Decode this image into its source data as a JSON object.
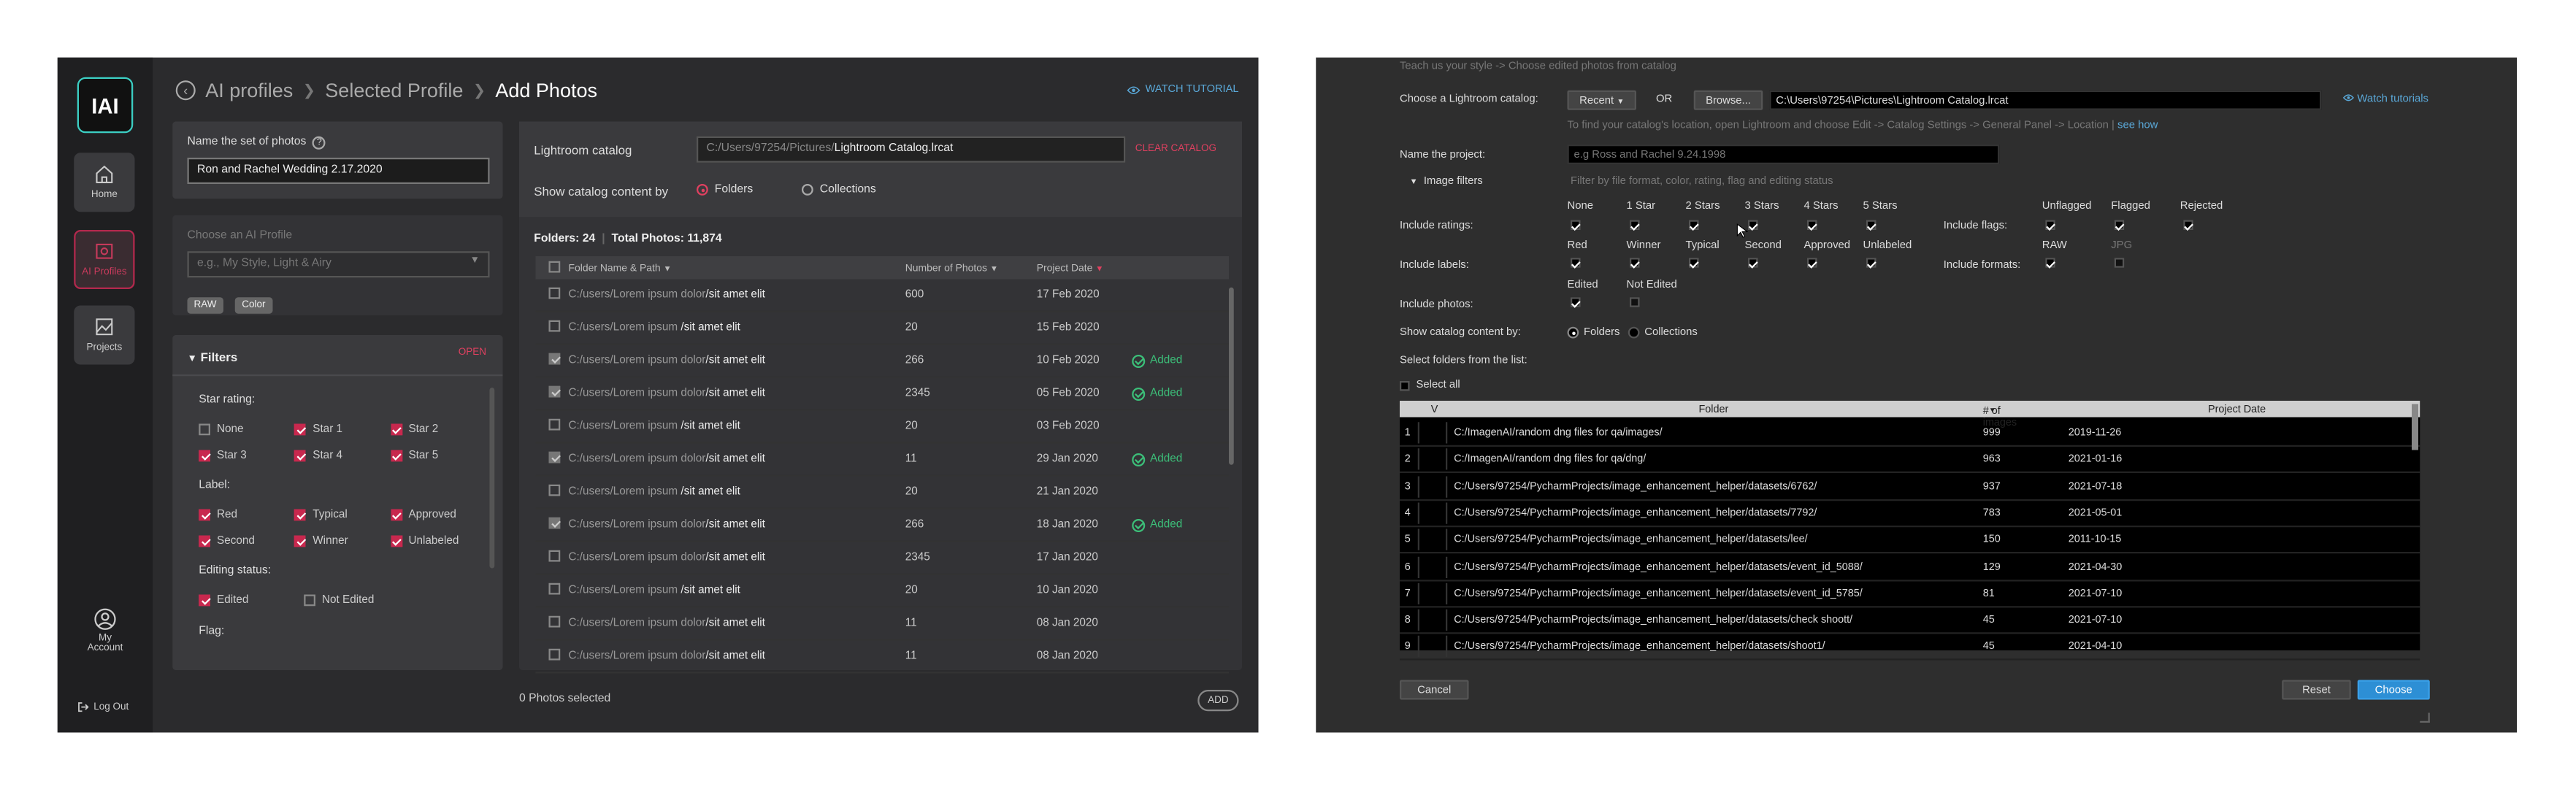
{
  "left": {
    "logo": "IAI",
    "nav": [
      {
        "label": "Home",
        "icon": "home-icon"
      },
      {
        "label": "AI Profiles",
        "icon": "ai-profiles-icon",
        "active": true
      },
      {
        "label": "Projects",
        "icon": "projects-icon"
      }
    ],
    "account_label_1": "My",
    "account_label_2": "Account",
    "logout_label": "Log Out",
    "breadcrumb": {
      "items": [
        "AI profiles",
        "Selected Profile"
      ],
      "current": "Add Photos"
    },
    "watch_tutorial": "WATCH TUTORIAL",
    "name_set": {
      "label": "Name the set of photos",
      "value": "Ron and Rachel Wedding 2.17.2020"
    },
    "ai_profile": {
      "label": "Choose an AI Profile",
      "placeholder": "e.g., My Style, Light & Airy",
      "tags": [
        "RAW",
        "Color"
      ]
    },
    "filters": {
      "title": "Filters",
      "open_label": "OPEN",
      "star_rating_label": "Star rating:",
      "stars": [
        {
          "label": "None",
          "checked": false
        },
        {
          "label": "Star 1",
          "checked": true
        },
        {
          "label": "Star 2",
          "checked": true
        },
        {
          "label": "Star 3",
          "checked": true
        },
        {
          "label": "Star 4",
          "checked": true
        },
        {
          "label": "Star 5",
          "checked": true
        }
      ],
      "label_label": "Label:",
      "labels": [
        {
          "label": "Red",
          "checked": true
        },
        {
          "label": "Typical",
          "checked": true
        },
        {
          "label": "Approved",
          "checked": true
        },
        {
          "label": "Second",
          "checked": true
        },
        {
          "label": "Winner",
          "checked": true
        },
        {
          "label": "Unlabeled",
          "checked": true
        }
      ],
      "editing_label": "Editing status:",
      "editing": [
        {
          "label": "Edited",
          "checked": true
        },
        {
          "label": "Not Edited",
          "checked": false
        }
      ],
      "flag_label": "Flag:"
    },
    "catalog": {
      "label": "Lightroom catalog",
      "path_prefix": "C:/Users/97254/Pictures/",
      "path_file": "Lightroom Catalog.lrcat",
      "clear": "CLEAR CATALOG",
      "show_by_label": "Show catalog content by",
      "options": [
        "Folders",
        "Collections"
      ],
      "folders_count": "Folders: 24",
      "total_photos": "Total Photos: 11,874"
    },
    "table": {
      "headers": [
        "Folder Name & Path",
        "Number of Photos",
        "Project Date"
      ],
      "rows": [
        {
          "prefix": "C:/users/Lorem ipsum dolor",
          "suffix": "/sit amet elit",
          "count": "600",
          "date": "17 Feb 2020",
          "status": "",
          "checked": false
        },
        {
          "prefix": "C:/users/Lorem ipsum",
          "suffix": " /sit amet elit",
          "count": "20",
          "date": "15 Feb 2020",
          "status": "",
          "checked": false
        },
        {
          "prefix": "C:/users/Lorem ipsum dolor",
          "suffix": "/sit amet elit",
          "count": "266",
          "date": "10 Feb 2020",
          "status": "Added",
          "checked": true
        },
        {
          "prefix": "C:/users/Lorem ipsum dolor",
          "suffix": "/sit amet elit",
          "count": "2345",
          "date": "05 Feb 2020",
          "status": "Added",
          "checked": true
        },
        {
          "prefix": "C:/users/Lorem ipsum",
          "suffix": " /sit amet elit",
          "count": "20",
          "date": "03 Feb 2020",
          "status": "",
          "checked": false
        },
        {
          "prefix": "C:/users/Lorem ipsum dolor",
          "suffix": "/sit amet elit",
          "count": "11",
          "date": "29 Jan 2020",
          "status": "Added",
          "checked": true
        },
        {
          "prefix": "C:/users/Lorem ipsum",
          "suffix": " /sit amet elit",
          "count": "20",
          "date": "21 Jan 2020",
          "status": "",
          "checked": false
        },
        {
          "prefix": "C:/users/Lorem ipsum dolor",
          "suffix": "/sit amet elit",
          "count": "266",
          "date": "18 Jan 2020",
          "status": "Added",
          "checked": true
        },
        {
          "prefix": "C:/users/Lorem ipsum dolor",
          "suffix": "/sit amet elit",
          "count": "2345",
          "date": "17 Jan 2020",
          "status": "",
          "checked": false
        },
        {
          "prefix": "C:/users/Lorem ipsum",
          "suffix": " /sit amet elit",
          "count": "20",
          "date": "10 Jan 2020",
          "status": "",
          "checked": false
        },
        {
          "prefix": "C:/users/Lorem ipsum dolor",
          "suffix": "/sit amet elit",
          "count": "11",
          "date": "08 Jan 2020",
          "status": "",
          "checked": false
        },
        {
          "prefix": "C:/users/Lorem ipsum dolor",
          "suffix": "/sit amet elit",
          "count": "11",
          "date": "08 Jan 2020",
          "status": "",
          "checked": false
        }
      ]
    },
    "selected_count": "0 Photos selected",
    "add_label": "ADD",
    "colors": {
      "accent": "#c8284e",
      "added": "#3cbf79",
      "link": "#5aa8d8",
      "logo_border": "#3ccfc4"
    }
  },
  "right": {
    "top_hint": "Teach us your style -> Choose edited photos from catalog",
    "catalog_label": "Choose a Lightroom catalog:",
    "recent_label": "Recent",
    "or_label": "OR",
    "browse_label": "Browse...",
    "catalog_path": "C:\\Users\\97254\\Pictures\\Lightroom Catalog.lrcat",
    "watch_label": "Watch tutorials",
    "catalog_hint": "To find your catalog's location, open Lightroom and choose  Edit -> Catalog Settings -> General Panel -> Location",
    "see_how": "see how",
    "project_label": "Name the project:",
    "project_placeholder": "e.g Ross and Rachel 9.24.1998",
    "filters_label": "Image filters",
    "filters_hint": "Filter by file format, color, rating, flag and editing status",
    "ratings_label": "Include ratings:",
    "ratings": [
      {
        "label": "None",
        "checked": true
      },
      {
        "label": "1 Star",
        "checked": true
      },
      {
        "label": "2 Stars",
        "checked": true
      },
      {
        "label": "3 Stars",
        "checked": true
      },
      {
        "label": "4 Stars",
        "checked": true
      },
      {
        "label": "5 Stars",
        "checked": true
      }
    ],
    "flags_label": "Include flags:",
    "flags": [
      {
        "label": "Unflagged",
        "checked": true
      },
      {
        "label": "Flagged",
        "checked": true
      },
      {
        "label": "Rejected",
        "checked": true
      }
    ],
    "labels_label": "Include labels:",
    "labels": [
      {
        "label": "Red",
        "checked": true
      },
      {
        "label": "Winner",
        "checked": true
      },
      {
        "label": "Typical",
        "checked": true
      },
      {
        "label": "Second",
        "checked": true
      },
      {
        "label": "Approved",
        "checked": true
      },
      {
        "label": "Unlabeled",
        "checked": true
      }
    ],
    "formats_label": "Include formats:",
    "formats": [
      {
        "label": "RAW",
        "checked": true
      },
      {
        "label": "JPG",
        "checked": false
      }
    ],
    "photos_label": "Include photos:",
    "photos": [
      {
        "label": "Edited",
        "checked": true
      },
      {
        "label": "Not Edited",
        "checked": false
      }
    ],
    "show_by_label": "Show catalog content by:",
    "show_options": [
      "Folders",
      "Collections"
    ],
    "select_folders_label": "Select folders from the list:",
    "select_all_label": "Select all",
    "grid": {
      "headers": [
        "V",
        "Folder",
        "# of images",
        "Project Date"
      ],
      "rows": [
        {
          "n": "1",
          "folder": "C:/ImagenAI/random dng files for qa/images/",
          "images": "999",
          "date": "2019-11-26"
        },
        {
          "n": "2",
          "folder": "C:/ImagenAI/random dng files for qa/dng/",
          "images": "963",
          "date": "2021-01-16"
        },
        {
          "n": "3",
          "folder": "C:/Users/97254/PycharmProjects/image_enhancement_helper/datasets/6762/",
          "images": "937",
          "date": "2021-07-18"
        },
        {
          "n": "4",
          "folder": "C:/Users/97254/PycharmProjects/image_enhancement_helper/datasets/7792/",
          "images": "783",
          "date": "2021-05-01"
        },
        {
          "n": "5",
          "folder": "C:/Users/97254/PycharmProjects/image_enhancement_helper/datasets/lee/",
          "images": "150",
          "date": "2011-10-15"
        },
        {
          "n": "6",
          "folder": "C:/Users/97254/PycharmProjects/image_enhancement_helper/datasets/event_id_5088/",
          "images": "129",
          "date": "2021-04-30"
        },
        {
          "n": "7",
          "folder": "C:/Users/97254/PycharmProjects/image_enhancement_helper/datasets/event_id_5785/",
          "images": "81",
          "date": "2021-07-10"
        },
        {
          "n": "8",
          "folder": "C:/Users/97254/PycharmProjects/image_enhancement_helper/datasets/check shoott/",
          "images": "45",
          "date": "2021-07-10"
        },
        {
          "n": "9",
          "folder": "C:/Users/97254/PycharmProjects/image_enhancement_helper/datasets/shoot1/",
          "images": "45",
          "date": "2021-04-10"
        }
      ]
    },
    "cancel_label": "Cancel",
    "reset_label": "Reset",
    "choose_label": "Choose",
    "colors": {
      "choose": "#2d8fd5",
      "link": "#5aa8d8"
    }
  }
}
